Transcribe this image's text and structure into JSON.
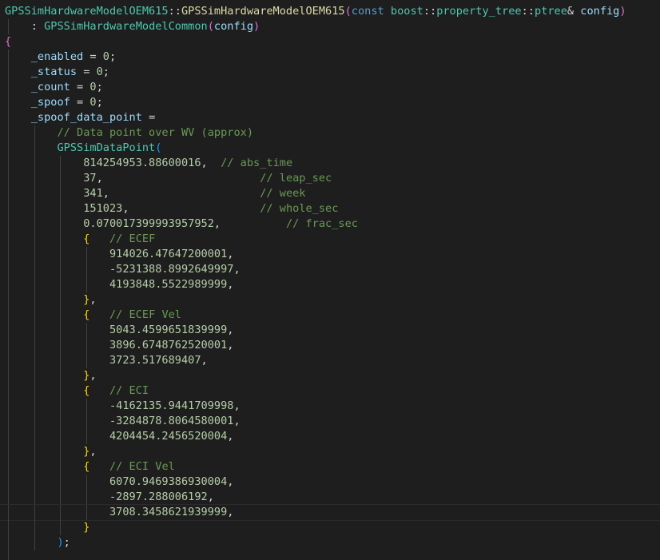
{
  "colors": {
    "background": "#1e1e1e",
    "type": "#4ec9b0",
    "function": "#dcdcaa",
    "keyword": "#569cd6",
    "variable": "#9cdcfe",
    "number": "#b5cea8",
    "comment": "#6a9955",
    "bracket_gold": "#ffd700",
    "bracket_orchid": "#da70d6",
    "bracket_blue": "#179fff"
  },
  "code": {
    "lines": [
      {
        "indent": "",
        "tokens": [
          {
            "t": "GPSSimHardwareModelOEM615",
            "c": "type"
          },
          {
            "t": "::",
            "c": "op"
          },
          {
            "t": "GPSSimHardwareModelOEM615",
            "c": "fn"
          },
          {
            "t": "(",
            "c": "b2"
          },
          {
            "t": "const",
            "c": "kw"
          },
          {
            "t": " ",
            "c": "op"
          },
          {
            "t": "boost",
            "c": "type"
          },
          {
            "t": "::",
            "c": "op"
          },
          {
            "t": "property_tree",
            "c": "type"
          },
          {
            "t": "::",
            "c": "op"
          },
          {
            "t": "ptree",
            "c": "type"
          },
          {
            "t": "& ",
            "c": "op"
          },
          {
            "t": "config",
            "c": "var"
          },
          {
            "t": ")",
            "c": "b2"
          }
        ]
      },
      {
        "indent": "    ",
        "tokens": [
          {
            "t": ": ",
            "c": "op"
          },
          {
            "t": "GPSSimHardwareModelCommon",
            "c": "type"
          },
          {
            "t": "(",
            "c": "b2"
          },
          {
            "t": "config",
            "c": "var"
          },
          {
            "t": ")",
            "c": "b2"
          }
        ]
      },
      {
        "indent": "",
        "tokens": [
          {
            "t": "{",
            "c": "b2"
          }
        ]
      },
      {
        "indent": "    ",
        "tokens": [
          {
            "t": "_enabled",
            "c": "var"
          },
          {
            "t": " = ",
            "c": "op"
          },
          {
            "t": "0",
            "c": "num"
          },
          {
            "t": ";",
            "c": "op"
          }
        ]
      },
      {
        "indent": "    ",
        "tokens": [
          {
            "t": "_status",
            "c": "var"
          },
          {
            "t": " = ",
            "c": "op"
          },
          {
            "t": "0",
            "c": "num"
          },
          {
            "t": ";",
            "c": "op"
          }
        ]
      },
      {
        "indent": "    ",
        "tokens": [
          {
            "t": "_count",
            "c": "var"
          },
          {
            "t": " = ",
            "c": "op"
          },
          {
            "t": "0",
            "c": "num"
          },
          {
            "t": ";",
            "c": "op"
          }
        ]
      },
      {
        "indent": "    ",
        "tokens": [
          {
            "t": "_spoof",
            "c": "var"
          },
          {
            "t": " = ",
            "c": "op"
          },
          {
            "t": "0",
            "c": "num"
          },
          {
            "t": ";",
            "c": "op"
          }
        ]
      },
      {
        "indent": "    ",
        "tokens": [
          {
            "t": "_spoof_data_point",
            "c": "var"
          },
          {
            "t": " =",
            "c": "op"
          }
        ]
      },
      {
        "indent": "        ",
        "tokens": [
          {
            "t": "// Data point over WV (approx)",
            "c": "cm"
          }
        ]
      },
      {
        "indent": "        ",
        "tokens": [
          {
            "t": "GPSSimDataPoint",
            "c": "type"
          },
          {
            "t": "(",
            "c": "b3"
          }
        ]
      },
      {
        "indent": "            ",
        "tokens": [
          {
            "t": "814254953.88600016",
            "c": "num"
          },
          {
            "t": ",  ",
            "c": "op"
          },
          {
            "t": "// abs_time",
            "c": "cm"
          }
        ]
      },
      {
        "indent": "            ",
        "tokens": [
          {
            "t": "37",
            "c": "num"
          },
          {
            "t": ",                        ",
            "c": "op"
          },
          {
            "t": "// leap_sec",
            "c": "cm"
          }
        ]
      },
      {
        "indent": "            ",
        "tokens": [
          {
            "t": "341",
            "c": "num"
          },
          {
            "t": ",                       ",
            "c": "op"
          },
          {
            "t": "// week",
            "c": "cm"
          }
        ]
      },
      {
        "indent": "            ",
        "tokens": [
          {
            "t": "151023",
            "c": "num"
          },
          {
            "t": ",                    ",
            "c": "op"
          },
          {
            "t": "// whole_sec",
            "c": "cm"
          }
        ]
      },
      {
        "indent": "            ",
        "tokens": [
          {
            "t": "0.070017399993957952",
            "c": "num"
          },
          {
            "t": ",          ",
            "c": "op"
          },
          {
            "t": "// frac_sec",
            "c": "cm"
          }
        ]
      },
      {
        "indent": "            ",
        "tokens": [
          {
            "t": "{",
            "c": "b1"
          },
          {
            "t": "   ",
            "c": "op"
          },
          {
            "t": "// ECEF",
            "c": "cm"
          }
        ]
      },
      {
        "indent": "                ",
        "tokens": [
          {
            "t": "914026.47647200001",
            "c": "num"
          },
          {
            "t": ",",
            "c": "op"
          }
        ]
      },
      {
        "indent": "                ",
        "tokens": [
          {
            "t": "-5231388.8992649997",
            "c": "num"
          },
          {
            "t": ",",
            "c": "op"
          }
        ]
      },
      {
        "indent": "                ",
        "tokens": [
          {
            "t": "4193848.5522989999",
            "c": "num"
          },
          {
            "t": ",",
            "c": "op"
          }
        ]
      },
      {
        "indent": "            ",
        "tokens": [
          {
            "t": "}",
            "c": "b1"
          },
          {
            "t": ",",
            "c": "op"
          }
        ]
      },
      {
        "indent": "            ",
        "tokens": [
          {
            "t": "{",
            "c": "b1"
          },
          {
            "t": "   ",
            "c": "op"
          },
          {
            "t": "// ECEF Vel",
            "c": "cm"
          }
        ]
      },
      {
        "indent": "                ",
        "tokens": [
          {
            "t": "5043.4599651839999",
            "c": "num"
          },
          {
            "t": ",",
            "c": "op"
          }
        ]
      },
      {
        "indent": "                ",
        "tokens": [
          {
            "t": "3896.6748762520001",
            "c": "num"
          },
          {
            "t": ",",
            "c": "op"
          }
        ]
      },
      {
        "indent": "                ",
        "tokens": [
          {
            "t": "3723.517689407",
            "c": "num"
          },
          {
            "t": ",",
            "c": "op"
          }
        ]
      },
      {
        "indent": "            ",
        "tokens": [
          {
            "t": "}",
            "c": "b1"
          },
          {
            "t": ",",
            "c": "op"
          }
        ]
      },
      {
        "indent": "            ",
        "tokens": [
          {
            "t": "{",
            "c": "b1"
          },
          {
            "t": "   ",
            "c": "op"
          },
          {
            "t": "// ECI",
            "c": "cm"
          }
        ]
      },
      {
        "indent": "                ",
        "tokens": [
          {
            "t": "-4162135.9441709998",
            "c": "num"
          },
          {
            "t": ",",
            "c": "op"
          }
        ]
      },
      {
        "indent": "                ",
        "tokens": [
          {
            "t": "-3284878.8064580001",
            "c": "num"
          },
          {
            "t": ",",
            "c": "op"
          }
        ]
      },
      {
        "indent": "                ",
        "tokens": [
          {
            "t": "4204454.2456520004",
            "c": "num"
          },
          {
            "t": ",",
            "c": "op"
          }
        ]
      },
      {
        "indent": "            ",
        "tokens": [
          {
            "t": "}",
            "c": "b1"
          },
          {
            "t": ",",
            "c": "op"
          }
        ]
      },
      {
        "indent": "            ",
        "tokens": [
          {
            "t": "{",
            "c": "b1"
          },
          {
            "t": "   ",
            "c": "op"
          },
          {
            "t": "// ECI Vel",
            "c": "cm"
          }
        ]
      },
      {
        "indent": "                ",
        "tokens": [
          {
            "t": "6070.9469386930004",
            "c": "num"
          },
          {
            "t": ",",
            "c": "op"
          }
        ]
      },
      {
        "indent": "                ",
        "tokens": [
          {
            "t": "-2897.288006192",
            "c": "num"
          },
          {
            "t": ",",
            "c": "op"
          }
        ]
      },
      {
        "indent": "                ",
        "current": true,
        "tokens": [
          {
            "t": "3708.3458621939999",
            "c": "num"
          },
          {
            "t": ",",
            "c": "op"
          }
        ]
      },
      {
        "indent": "            ",
        "tokens": [
          {
            "t": "}",
            "c": "b1"
          }
        ]
      },
      {
        "indent": "        ",
        "tokens": [
          {
            "t": ")",
            "c": "b3"
          },
          {
            "t": ";",
            "c": "op"
          }
        ]
      },
      {
        "indent": "    ",
        "tokens": []
      }
    ]
  }
}
